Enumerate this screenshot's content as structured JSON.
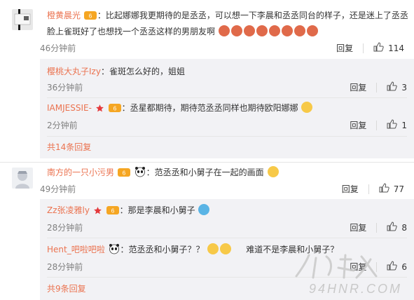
{
  "comments": [
    {
      "username": "橙黄晨光",
      "text_a": "：比起娜娜我更期待的是丞丞，可以想一下李晨和丞丞同台的样子，还是迷上了丞丞",
      "text_b": "脸上雀斑好了也想找一个丞丞这样的男朋友啊",
      "time": "46分钟前",
      "reply_label": "回复",
      "likes": "114",
      "replies": [
        {
          "username": "樱桃大丸子Izy",
          "text": "：雀斑怎么好的，姐姐",
          "time": "36分钟前",
          "reply_label": "回复",
          "likes": "3"
        },
        {
          "username": "IAMJESSIE-",
          "text": "：丞星都期待，期待范丞丞同样也期待欧阳娜娜",
          "time": "2分钟前",
          "reply_label": "回复",
          "likes": "1"
        }
      ],
      "more_replies": "共14条回复"
    },
    {
      "username": "南方的一只小污男",
      "text": "：范丞丞和小舅子在一起的画面",
      "time": "49分钟前",
      "reply_label": "回复",
      "likes": "77",
      "replies": [
        {
          "username": "Zz张凌雅ly",
          "text": "：那是李晨和小舅子",
          "time": "28分钟前",
          "reply_label": "回复",
          "likes": "8"
        },
        {
          "username": "Hent_吧啦吧啦",
          "text": "：范丞丞和小舅子？？",
          "text_after": "难道不是李晨和小舅子？",
          "time": "28分钟前",
          "reply_label": "回复",
          "likes": "6"
        }
      ],
      "more_replies": "共9条回复"
    }
  ],
  "watermark_lines": [
    "94HNR.COM"
  ],
  "icons": {
    "like": "thumbs-up-icon",
    "vip": "vip-crown-icon",
    "star": "red-star-icon",
    "panda": "panda-emoji-icon",
    "laugh": "laugh-emoji-icon",
    "heart_eyes": "heart-eyes-emoji-icon",
    "kiss": "kiss-emoji-icon",
    "hug": "hug-emoji-icon"
  },
  "colors": {
    "username": "#eb7350",
    "time": "#808080",
    "reply_bg": "#f2f2f5",
    "divider": "#e6e6e6"
  }
}
